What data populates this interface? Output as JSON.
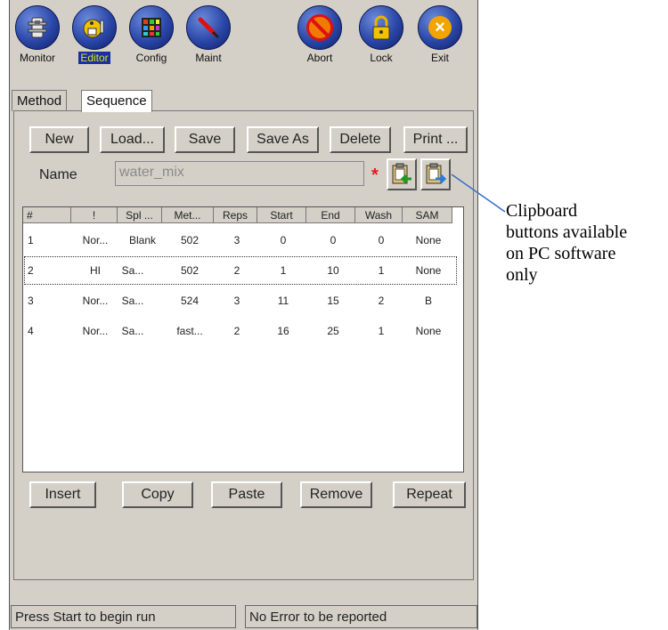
{
  "toolbar": {
    "items": [
      {
        "label": "Monitor",
        "icon": "monitor-icon"
      },
      {
        "label": "Editor",
        "icon": "editor-icon",
        "active": true
      },
      {
        "label": "Config",
        "icon": "config-icon"
      },
      {
        "label": "Maint",
        "icon": "maint-icon"
      },
      {
        "label": "Abort",
        "icon": "abort-icon"
      },
      {
        "label": "Lock",
        "icon": "lock-icon"
      },
      {
        "label": "Exit",
        "icon": "exit-icon"
      }
    ]
  },
  "tabs": [
    {
      "label": "Method"
    },
    {
      "label": "Sequence",
      "active": true
    }
  ],
  "actions": {
    "new": "New",
    "load": "Load...",
    "save": "Save",
    "save_as": "Save As",
    "delete": "Delete",
    "print": "Print ..."
  },
  "name": {
    "label": "Name",
    "value": "water_mix",
    "required_marker": "*"
  },
  "table": {
    "columns": [
      "#",
      "!",
      "Spl ...",
      "Met...",
      "Reps",
      "Start",
      "End",
      "Wash",
      "SAM"
    ],
    "rows": [
      [
        "1",
        "Nor...",
        "Blank",
        "502",
        "3",
        "0",
        "0",
        "0",
        "None"
      ],
      [
        "2",
        "HI",
        "Sa...",
        "502",
        "2",
        "1",
        "10",
        "1",
        "None"
      ],
      [
        "3",
        "Nor...",
        "Sa...",
        "524",
        "3",
        "11",
        "15",
        "2",
        "B"
      ],
      [
        "4",
        "Nor...",
        "Sa...",
        "fast...",
        "2",
        "16",
        "25",
        "1",
        "None"
      ]
    ]
  },
  "row_actions": {
    "insert": "Insert",
    "copy": "Copy",
    "paste": "Paste",
    "remove": "Remove",
    "repeat": "Repeat"
  },
  "status": {
    "left": "Press Start to begin run",
    "right": "No Error to be reported"
  },
  "annotation": {
    "lines": [
      "Clipboard",
      "buttons available",
      "on PC software",
      "only"
    ]
  },
  "colors": {
    "panel": "#d4d0c8",
    "active_label_bg": "#1c2f9e",
    "active_label_fg": "#d6e81a",
    "required": "#e21a1a"
  }
}
